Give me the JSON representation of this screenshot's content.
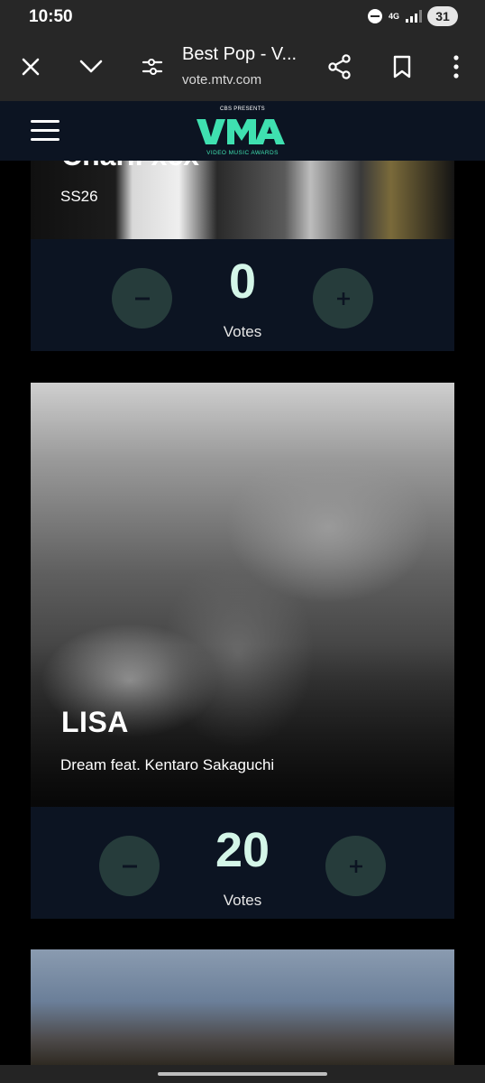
{
  "status": {
    "time": "10:50",
    "network": "4G",
    "battery": "31"
  },
  "browser": {
    "title": "Best Pop - V...",
    "url": "vote.mtv.com"
  },
  "header": {
    "presenter": "CBS PRESENTS",
    "logo_text": "VMA",
    "logo_sub": "VIDEO MUSIC AWARDS"
  },
  "cards": [
    {
      "artist_partial": "Charli xcx",
      "song": "SS26",
      "votes": "0",
      "votes_label": "Votes"
    },
    {
      "artist": "LISA",
      "song": "Dream feat. Kentaro Sakaguchi",
      "votes": "20",
      "votes_label": "Votes"
    }
  ],
  "colors": {
    "accent": "#d4f6e8",
    "panel": "#0c1422",
    "vote_button": "#263c3b",
    "logo": "#3fe0b0"
  }
}
